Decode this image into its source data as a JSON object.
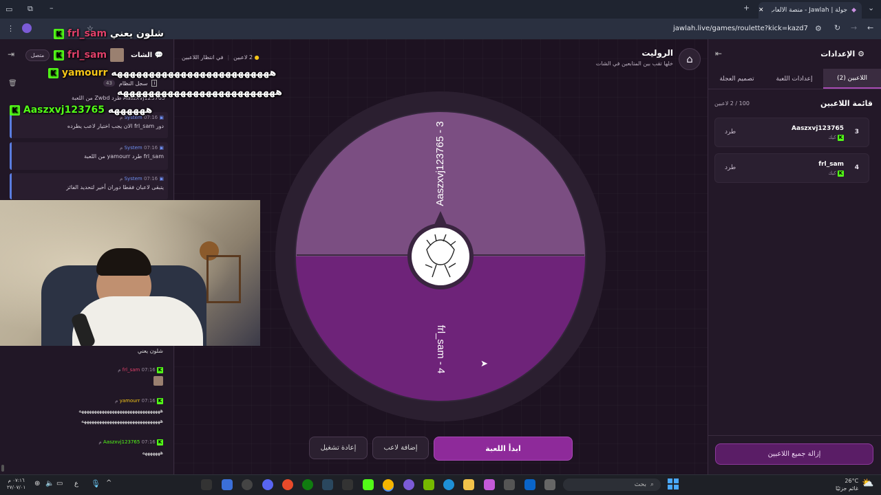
{
  "browser": {
    "tab_title": "جولة | Jawlah - منصة الألعاب الت...",
    "url": "jawlah.live/games/roulette?kick=kazd7"
  },
  "overlay_chat": [
    {
      "user": "frl_sam",
      "text": "شلون يعني"
    },
    {
      "user": "frl_sam",
      "text": ""
    },
    {
      "user": "yamourr",
      "text": "هههههههههههههههههههههههههه"
    },
    {
      "user": "",
      "text": "هههههههههههههههههههههههههه"
    },
    {
      "user": "Aaszxvj123765",
      "text": "ههههههه"
    }
  ],
  "chat": {
    "online_label": "متصل",
    "title": "الشات",
    "system_log_label": "سجل النظام",
    "system_log_count": "43",
    "top_line": "Aaszxvj123765 طرد Zwbd من اللعبة",
    "system_messages": [
      {
        "author": "System",
        "time": "07:16 م",
        "text": "دور frl_sam الان يجب اختيار لاعب يطرده"
      },
      {
        "author": "System",
        "time": "07:16 م",
        "text": "frl_sam طرد yamourr من اللعبة"
      },
      {
        "author": "System",
        "time": "07:16 م",
        "text": "يتبقى لاعبان فقطا دوران أخير لتحديد الفائز"
      }
    ],
    "messages": [
      {
        "user": "",
        "time": "",
        "text": "شلون يعني"
      },
      {
        "user": "frl_sam",
        "time": "07:16 م",
        "text": ""
      },
      {
        "user": "yamourr",
        "time": "07:16 م",
        "text": "ههههههههههههههههههههههههههههههههه"
      },
      {
        "user": "",
        "time": "",
        "text": "هههههههههههههههههههههههههههههههه"
      },
      {
        "user": "Aaszxvj123765",
        "time": "07:16 م",
        "text": "هههههههه"
      }
    ]
  },
  "header": {
    "title": "الروليت",
    "subtitle": "خلها تقب بين المتابعين في الشات",
    "player_count": "2 لاعبين",
    "status": "في انتظار اللاعبين"
  },
  "wheel": {
    "segments": [
      {
        "label": "Aaszxvj123765 - 3",
        "color": "#7b4e82"
      },
      {
        "label": "frl_sam - 4",
        "color": "#6e2379"
      }
    ]
  },
  "actions": {
    "start": "ابدأ اللعبة",
    "add_player": "إضافة لاعب",
    "restart": "إعادة تشغيل"
  },
  "settings": {
    "title": "الإعدادات",
    "tabs": [
      "اللاعبين (2)",
      "إعدادات اللعبة",
      "تصميم العجلة"
    ],
    "list_title": "قائمة اللاعبين",
    "capacity": "100 / 2 لاعبين",
    "players": [
      {
        "num": "3",
        "name": "Aaszxvj123765",
        "platform": "كيك",
        "kick_label": "طرد"
      },
      {
        "num": "4",
        "name": "frl_sam",
        "platform": "كيك",
        "kick_label": "طرد"
      }
    ],
    "remove_all": "إزالة جميع اللاعبين"
  },
  "taskbar": {
    "search": "بحث",
    "weather_temp": "26°C",
    "weather_text": "غائم جزئيًا",
    "time": "٠٧:١٦ م",
    "date": "٢٧/٠٧/٠١",
    "lang": "ع"
  },
  "colors": {
    "accent": "#8e2a9a",
    "background": "#1c1220",
    "kick_green": "#53fc18"
  }
}
